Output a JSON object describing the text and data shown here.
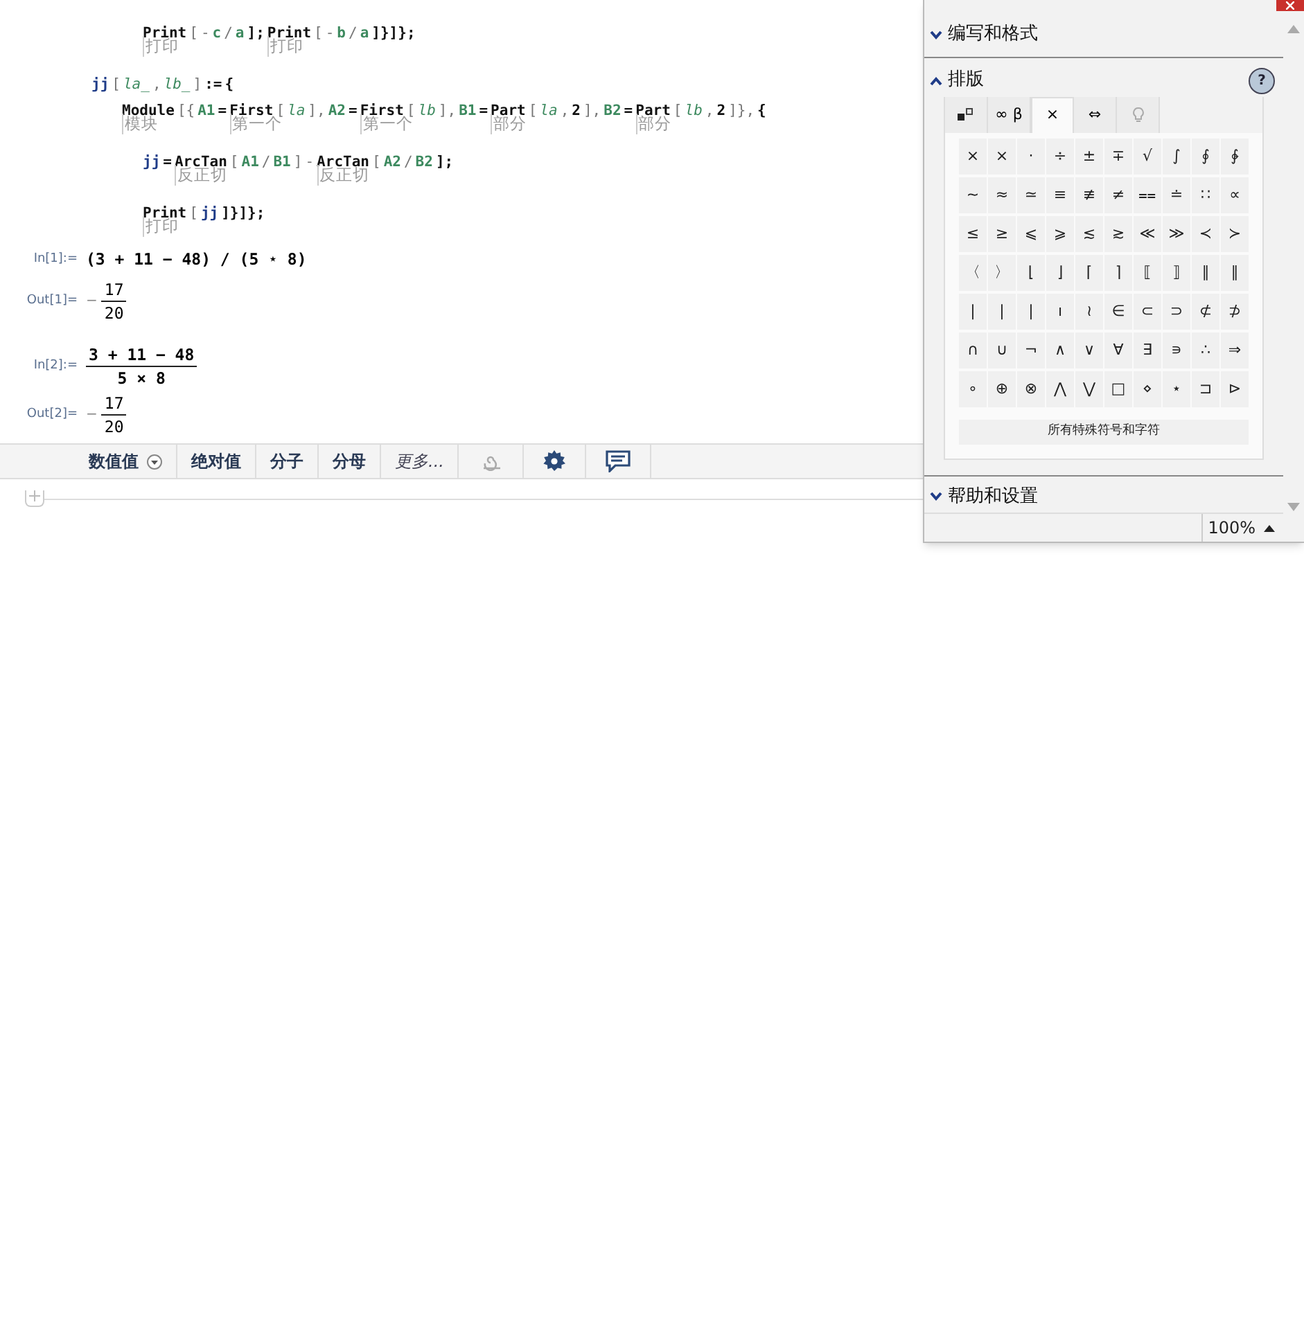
{
  "code_lines": [
    {
      "tokens": [
        {
          "t": "Print",
          "kind": "fn",
          "note": "打印"
        },
        {
          "t": "[",
          "kind": "op"
        },
        {
          "t": "-",
          "kind": "op"
        },
        {
          "t": "c",
          "kind": "local"
        },
        {
          "t": "/",
          "kind": "op"
        },
        {
          "t": "a",
          "kind": "local"
        },
        {
          "t": "];",
          "kind": "fn"
        },
        {
          "t": "Print",
          "kind": "fn",
          "note": "打印"
        },
        {
          "t": "[",
          "kind": "op"
        },
        {
          "t": "-",
          "kind": "op"
        },
        {
          "t": "b",
          "kind": "local"
        },
        {
          "t": "/",
          "kind": "op"
        },
        {
          "t": "a",
          "kind": "local"
        },
        {
          "t": "]}]};",
          "kind": "fn"
        }
      ]
    },
    {
      "tokens": [
        {
          "t": "jj",
          "kind": "var"
        },
        {
          "t": "[",
          "kind": "op"
        },
        {
          "t": "la_",
          "kind": "pat"
        },
        {
          "t": ",",
          "kind": "op"
        },
        {
          "t": "lb_",
          "kind": "pat"
        },
        {
          "t": "]",
          "kind": "op"
        },
        {
          "t": ":=",
          "kind": "fn"
        },
        {
          "t": "{",
          "kind": "fn"
        }
      ]
    },
    {
      "tokens": [
        {
          "t": "Module",
          "kind": "fn",
          "note": "模块"
        },
        {
          "t": "[{",
          "kind": "op"
        },
        {
          "t": "A1",
          "kind": "local"
        },
        {
          "t": "=",
          "kind": "fn"
        },
        {
          "t": "First",
          "kind": "fn",
          "note": "第一个"
        },
        {
          "t": "[",
          "kind": "op"
        },
        {
          "t": "la",
          "kind": "pat"
        },
        {
          "t": "],",
          "kind": "op"
        },
        {
          "t": "A2",
          "kind": "local"
        },
        {
          "t": "=",
          "kind": "fn"
        },
        {
          "t": "First",
          "kind": "fn",
          "note": "第一个"
        },
        {
          "t": "[",
          "kind": "op"
        },
        {
          "t": "lb",
          "kind": "pat"
        },
        {
          "t": "],",
          "kind": "op"
        },
        {
          "t": "B1",
          "kind": "local"
        },
        {
          "t": "=",
          "kind": "fn"
        },
        {
          "t": "Part",
          "kind": "fn",
          "note": "部分"
        },
        {
          "t": "[",
          "kind": "op"
        },
        {
          "t": "la",
          "kind": "pat"
        },
        {
          "t": ",",
          "kind": "op"
        },
        {
          "t": "2",
          "kind": "fn"
        },
        {
          "t": "],",
          "kind": "op"
        },
        {
          "t": "B2",
          "kind": "local"
        },
        {
          "t": "=",
          "kind": "fn"
        },
        {
          "t": "Part",
          "kind": "fn",
          "note": "部分"
        },
        {
          "t": "[",
          "kind": "op"
        },
        {
          "t": "lb",
          "kind": "pat"
        },
        {
          "t": ",",
          "kind": "op"
        },
        {
          "t": "2",
          "kind": "fn"
        },
        {
          "t": "]},",
          "kind": "op"
        },
        {
          "t": "{",
          "kind": "fn"
        }
      ]
    },
    {
      "tokens": [
        {
          "t": "jj",
          "kind": "var"
        },
        {
          "t": "=",
          "kind": "fn"
        },
        {
          "t": "ArcTan",
          "kind": "fn",
          "note": "反正切"
        },
        {
          "t": "[",
          "kind": "op"
        },
        {
          "t": "A1",
          "kind": "local"
        },
        {
          "t": "/",
          "kind": "op"
        },
        {
          "t": "B1",
          "kind": "local"
        },
        {
          "t": "]",
          "kind": "op"
        },
        {
          "t": "-",
          "kind": "op"
        },
        {
          "t": "ArcTan",
          "kind": "fn",
          "note": "反正切"
        },
        {
          "t": "[",
          "kind": "op"
        },
        {
          "t": "A2",
          "kind": "local"
        },
        {
          "t": "/",
          "kind": "op"
        },
        {
          "t": "B2",
          "kind": "local"
        },
        {
          "t": "];",
          "kind": "fn"
        }
      ]
    },
    {
      "tokens": [
        {
          "t": "Print",
          "kind": "fn",
          "note": "打印"
        },
        {
          "t": "[",
          "kind": "op"
        },
        {
          "t": "jj",
          "kind": "var"
        },
        {
          "t": "]}]};",
          "kind": "fn"
        }
      ]
    }
  ],
  "cells": [
    {
      "label": "In[1]:=",
      "kind": "input",
      "text": "(3 + 11 − 48) / (5 ⋆ 8)"
    },
    {
      "label": "Out[1]=",
      "kind": "output",
      "sign": "−",
      "numerator": "17",
      "denominator": "20"
    },
    {
      "label": "In[2]:=",
      "kind": "input-fraction",
      "numerator": "3 + 11 − 48",
      "denominator": "5 × 8"
    },
    {
      "label": "Out[2]=",
      "kind": "output",
      "sign": "−",
      "numerator": "17",
      "denominator": "20"
    }
  ],
  "suggestion_bar": [
    {
      "kind": "dropdown",
      "label": "数值值"
    },
    {
      "kind": "text",
      "label": "绝对值"
    },
    {
      "kind": "text",
      "label": "分子"
    },
    {
      "kind": "text",
      "label": "分母"
    },
    {
      "kind": "more",
      "label": "更多..."
    },
    {
      "kind": "spiral"
    },
    {
      "kind": "gear"
    },
    {
      "kind": "chat"
    }
  ],
  "palette": {
    "sections": [
      {
        "label": "编写和格式",
        "expanded": false
      },
      {
        "label": "排版",
        "expanded": true
      },
      {
        "label": "帮助和设置",
        "expanded": false
      }
    ],
    "help": "?",
    "tabs": [
      {
        "kind": "box",
        "selected": false
      },
      {
        "kind": "text",
        "label": "∞ β",
        "selected": false
      },
      {
        "kind": "text",
        "label": "×",
        "selected": true
      },
      {
        "kind": "text",
        "label": "⇔",
        "selected": false
      },
      {
        "kind": "bulb",
        "selected": false
      }
    ],
    "symbols": [
      [
        "×",
        "×",
        "·",
        "÷",
        "±",
        "∓",
        "√",
        "∫",
        "∮",
        "∲"
      ],
      [
        "∼",
        "≈",
        "≃",
        "≡",
        "≢",
        "≠",
        "⩵",
        "≐",
        "∷",
        "∝"
      ],
      [
        "≤",
        "≥",
        "⩽",
        "⩾",
        "≲",
        "≳",
        "≪",
        "≫",
        "≺",
        "≻"
      ],
      [
        "〈",
        "〉",
        "⌊",
        "⌋",
        "⌈",
        "⌉",
        "⟦",
        "⟧",
        "∥",
        "∥"
      ],
      [
        "|",
        "|",
        "|",
        "ı",
        "≀",
        "∈",
        "⊂",
        "⊃",
        "⊄",
        "⊅"
      ],
      [
        "∩",
        "∪",
        "¬",
        "∧",
        "∨",
        "∀",
        "∃",
        "∍",
        "∴",
        "⇒"
      ],
      [
        "∘",
        "⊕",
        "⊗",
        "⋀",
        "⋁",
        "□",
        "⋄",
        "⋆",
        "⊐",
        "⊳"
      ]
    ],
    "all_symbols_button": "所有特殊符号和字符",
    "zoom": "100%"
  }
}
